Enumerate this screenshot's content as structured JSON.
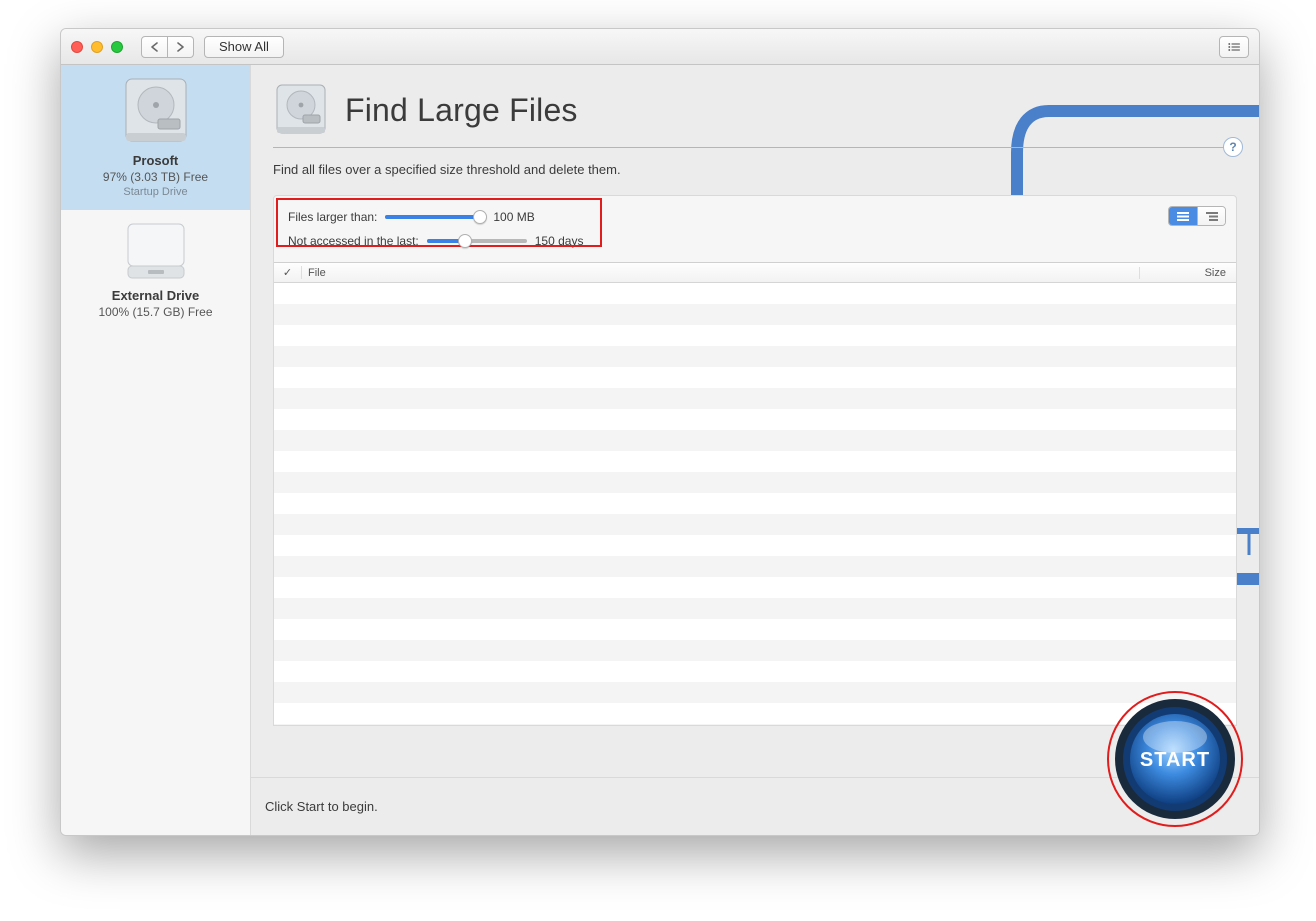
{
  "toolbar": {
    "show_all_label": "Show All"
  },
  "sidebar": {
    "drives": [
      {
        "name": "Prosoft",
        "free_line": "97% (3.03 TB) Free",
        "note": "Startup Drive",
        "selected": true,
        "kind": "internal"
      },
      {
        "name": "External Drive",
        "free_line": "100% (15.7 GB) Free",
        "note": "",
        "selected": false,
        "kind": "external"
      }
    ]
  },
  "header": {
    "title": "Find Large Files",
    "help_label": "?"
  },
  "description": "Find all files over a specified size threshold and delete them.",
  "controls": {
    "size_label": "Files larger than:",
    "size_value": "100 MB",
    "size_pct": 95,
    "accessed_label": "Not accessed in the last:",
    "accessed_value": "150 days",
    "accessed_pct": 38
  },
  "table": {
    "columns": {
      "check": "✓",
      "file": "File",
      "size": "Size"
    },
    "rows": 22
  },
  "footer": {
    "hint": "Click Start to begin."
  },
  "start_button": {
    "label": "START"
  },
  "colors": {
    "accent_blue": "#4a8be3",
    "highlight_red": "#e11c1c"
  }
}
